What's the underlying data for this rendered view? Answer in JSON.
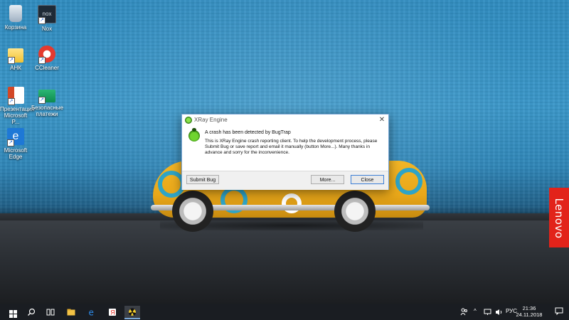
{
  "desktop": {
    "icons": [
      {
        "label": "Корзина",
        "icon": "recycle-bin-icon"
      },
      {
        "label": "Nox",
        "icon": "nox-icon",
        "badge": "nox"
      },
      {
        "label": "АНК",
        "icon": "folder-icon"
      },
      {
        "label": "CCleaner",
        "icon": "ccleaner-icon"
      },
      {
        "label": "Презентация Microsoft P...",
        "icon": "powerpoint-icon"
      },
      {
        "label": "Безопасные платежи",
        "icon": "safe-money-icon"
      },
      {
        "label": "Microsoft Edge",
        "icon": "edge-icon"
      }
    ],
    "brand_tab": "Lenovo"
  },
  "dialog": {
    "title": "XRay Engine",
    "close_glyph": "✕",
    "headline": "A crash has been detected by BugTrap",
    "body": "This is XRay Engine crash reporting client. To help the development process, please Submit Bug or save report and email it manually (button More...). Many thanks in advance and sorry for the inconvenience.",
    "buttons": {
      "submit": "Submit Bug",
      "more": "More...",
      "close": "Close"
    }
  },
  "taskbar": {
    "apps": [
      "start-icon",
      "search-icon",
      "task-view-icon",
      "file-explorer-icon",
      "edge-icon",
      "yandex-browser-icon",
      "xray-engine-icon"
    ],
    "language": "РУС",
    "time": "21:36",
    "date": "24.11.2018"
  },
  "colors": {
    "wall": "#2f8cc0",
    "car": "#f2b526",
    "lenovo": "#e2231a",
    "taskbar": "#1a1d22"
  }
}
